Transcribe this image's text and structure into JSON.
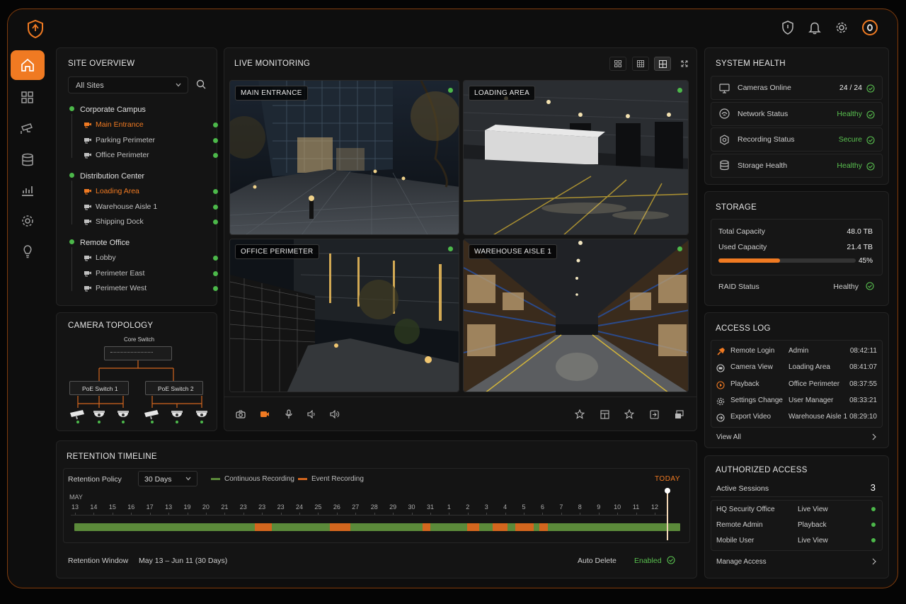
{
  "header": {
    "icons": [
      "shield-logo-icon",
      "shield-icon",
      "bell-icon",
      "gear-icon",
      "profile-icon"
    ]
  },
  "sidebar": {
    "items": [
      {
        "icon": "home-icon",
        "active": true
      },
      {
        "icon": "grid-icon",
        "active": false
      },
      {
        "icon": "camera-icon",
        "active": false
      },
      {
        "icon": "database-icon",
        "active": false
      },
      {
        "icon": "chart-icon",
        "active": false
      },
      {
        "icon": "settings-icon",
        "active": false
      },
      {
        "icon": "bulb-icon",
        "active": false
      }
    ]
  },
  "site_overview": {
    "title": "SITE OVERVIEW",
    "select_value": "All Sites",
    "groups": [
      {
        "name": "Corporate Campus",
        "items": [
          {
            "label": "Main Entrance",
            "selected": true
          },
          {
            "label": "Parking Perimeter",
            "selected": false
          },
          {
            "label": "Office Perimeter",
            "selected": false
          }
        ]
      },
      {
        "name": "Distribution Center",
        "items": [
          {
            "label": "Loading Area",
            "selected": true
          },
          {
            "label": "Warehouse Aisle 1",
            "selected": false
          },
          {
            "label": "Shipping Dock",
            "selected": false
          }
        ]
      },
      {
        "name": "Remote Office",
        "items": [
          {
            "label": "Lobby",
            "selected": false
          },
          {
            "label": "Perimeter East",
            "selected": false
          },
          {
            "label": "Perimeter West",
            "selected": false
          }
        ]
      }
    ]
  },
  "topology": {
    "title": "CAMERA TOPOLOGY",
    "core": "Core Switch",
    "switch1": "PoE Switch 1",
    "switch2": "PoE Switch 2"
  },
  "live": {
    "title": "LIVE MONITORING",
    "cameras": [
      "MAIN ENTRANCE",
      "LOADING AREA",
      "OFFICE PERIMETER",
      "WAREHOUSE AISLE 1"
    ]
  },
  "system_health": {
    "title": "SYSTEM HEALTH",
    "rows": [
      {
        "label": "Cameras Online",
        "value": "24 / 24",
        "icon": "monitor-icon"
      },
      {
        "label": "Network Status",
        "value": "Healthy",
        "icon": "network-icon"
      },
      {
        "label": "Recording Status",
        "value": "Secure",
        "icon": "record-icon"
      },
      {
        "label": "Storage Health",
        "value": "Healthy",
        "icon": "storage-icon"
      }
    ]
  },
  "storage": {
    "title": "STORAGE",
    "total_label": "Total Capacity",
    "total_value": "48.0 TB",
    "used_label": "Used Capacity",
    "used_value": "21.4 TB",
    "used_pct": "45%",
    "used_fraction": 0.45,
    "raid_label": "RAID Status",
    "raid_value": "Healthy"
  },
  "access_log": {
    "title": "ACCESS LOG",
    "rows": [
      {
        "event": "Remote Login",
        "subject": "Admin",
        "time": "08:42:11",
        "icon": "key-icon"
      },
      {
        "event": "Camera View",
        "subject": "Loading Area",
        "time": "08:41:07",
        "icon": "camera-view-icon"
      },
      {
        "event": "Playback",
        "subject": "Office Perimeter",
        "time": "08:37:55",
        "icon": "play-icon"
      },
      {
        "event": "Settings Change",
        "subject": "User Manager",
        "time": "08:33:21",
        "icon": "cog-icon"
      },
      {
        "event": "Export Video",
        "subject": "Warehouse Aisle 1",
        "time": "08:29:10",
        "icon": "export-icon"
      }
    ],
    "view_all": "View All"
  },
  "authorized": {
    "title": "AUTHORIZED ACCESS",
    "active_label": "Active Sessions",
    "active_count": "3",
    "sessions": [
      {
        "name": "HQ Security Office",
        "mode": "Live View"
      },
      {
        "name": "Remote Admin",
        "mode": "Playback"
      },
      {
        "name": "Mobile User",
        "mode": "Live View"
      }
    ],
    "manage": "Manage Access"
  },
  "retention": {
    "title": "RETENTION TIMELINE",
    "policy_label": "Retention Policy",
    "policy_value": "30 Days",
    "legend_continuous": "Continuous Recording",
    "legend_event": "Event Recording",
    "today": "TODAY",
    "month": "MAY",
    "ticks": [
      "13",
      "14",
      "15",
      "16",
      "17",
      "13",
      "19",
      "20",
      "21",
      "23",
      "23",
      "23",
      "24",
      "25",
      "26",
      "27",
      "28",
      "29",
      "30",
      "31",
      "1",
      "2",
      "3",
      "4",
      "5",
      "6",
      "7",
      "8",
      "9",
      "10",
      "11",
      "12"
    ],
    "window_label": "Retention Window",
    "window_value": "May 13 – Jun 11 (30 Days)",
    "auto_delete_label": "Auto Delete",
    "auto_delete_value": "Enabled",
    "event_segments": [
      [
        0.298,
        0.326
      ],
      [
        0.422,
        0.456
      ],
      [
        0.575,
        0.588
      ],
      [
        0.648,
        0.668
      ],
      [
        0.69,
        0.715
      ],
      [
        0.728,
        0.758
      ],
      [
        0.768,
        0.781
      ]
    ],
    "colors": {
      "continuous": "#5b8a3a",
      "event": "#d3661e"
    }
  }
}
